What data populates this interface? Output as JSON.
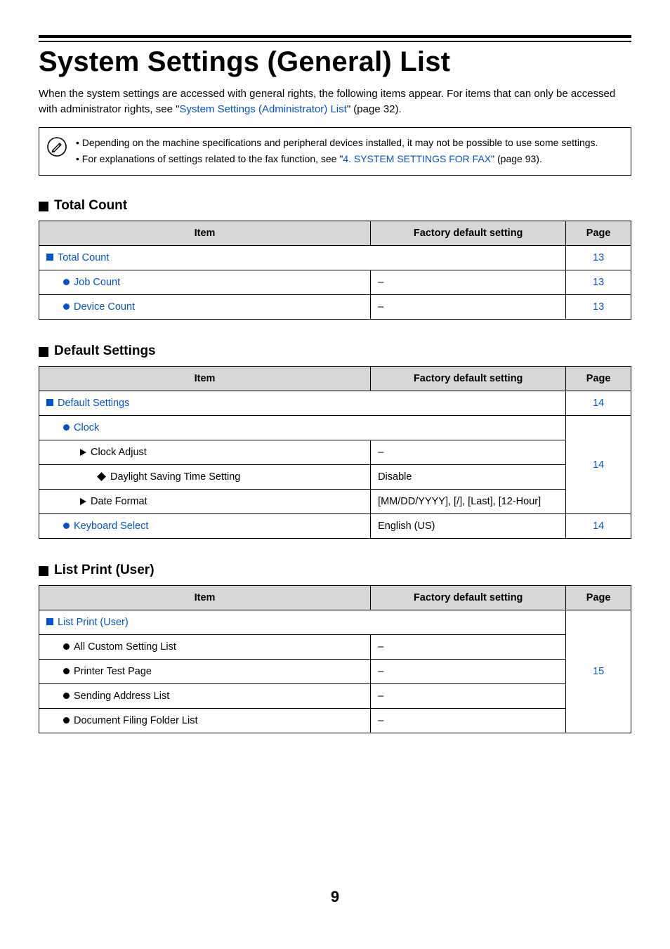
{
  "title": "System Settings (General) List",
  "intro": {
    "text_before": "When the system settings are accessed with general rights, the following items appear. For items that can only be accessed with administrator rights, see \"",
    "link": "System Settings (Administrator) List",
    "text_after": "\" (page 32)."
  },
  "note": {
    "line1_before": "• Depending on the machine specifications and peripheral devices installed, it may not be possible to use some settings.",
    "line2_before": "• For explanations of settings related to the fax function, see \"",
    "line2_link": "4. SYSTEM SETTINGS FOR FAX",
    "line2_after": "\" (page 93)."
  },
  "headers": {
    "item": "Item",
    "default": "Factory default setting",
    "page": "Page"
  },
  "sections": [
    {
      "heading": "Total Count",
      "rows": [
        {
          "indent": 0,
          "marker": "square",
          "label": "Total Count",
          "link": true,
          "default": null,
          "page": "13",
          "span_item": true
        },
        {
          "indent": 1,
          "marker": "circle",
          "label": "Job Count",
          "link": true,
          "default": "–",
          "page": "13"
        },
        {
          "indent": 1,
          "marker": "circle",
          "label": "Device Count",
          "link": true,
          "default": "–",
          "page": "13"
        }
      ]
    },
    {
      "heading": "Default Settings",
      "rows": [
        {
          "indent": 0,
          "marker": "square",
          "label": "Default Settings",
          "link": true,
          "default": null,
          "page": "14",
          "span_item": true
        },
        {
          "indent": 1,
          "marker": "circle",
          "label": "Clock",
          "link": true,
          "default": null,
          "span_item": true,
          "page_group_start": true,
          "page_group_span": 4,
          "page": "14"
        },
        {
          "indent": 2,
          "marker": "tri",
          "label": "Clock Adjust",
          "link": false,
          "default": "–"
        },
        {
          "indent": 3,
          "marker": "diamond",
          "label": "Daylight Saving Time Setting",
          "link": false,
          "default": "Disable"
        },
        {
          "indent": 2,
          "marker": "tri",
          "label": "Date Format",
          "link": false,
          "default": "[MM/DD/YYYY], [/], [Last], [12-Hour]"
        },
        {
          "indent": 1,
          "marker": "circle",
          "label": "Keyboard Select",
          "link": true,
          "default": "English (US)",
          "page": "14"
        }
      ]
    },
    {
      "heading": "List Print (User)",
      "rows": [
        {
          "indent": 0,
          "marker": "square",
          "label": "List Print (User)",
          "link": true,
          "default": null,
          "span_item": true,
          "page_group_start": true,
          "page_group_span": 5,
          "page": "15"
        },
        {
          "indent": 1,
          "marker": "circle",
          "label": "All Custom Setting List",
          "link": false,
          "default": "–"
        },
        {
          "indent": 1,
          "marker": "circle",
          "label": "Printer Test Page",
          "link": false,
          "default": "–"
        },
        {
          "indent": 1,
          "marker": "circle",
          "label": "Sending Address List",
          "link": false,
          "default": "–"
        },
        {
          "indent": 1,
          "marker": "circle",
          "label": "Document Filing Folder List",
          "link": false,
          "default": "–"
        }
      ]
    }
  ],
  "page_number": "9"
}
